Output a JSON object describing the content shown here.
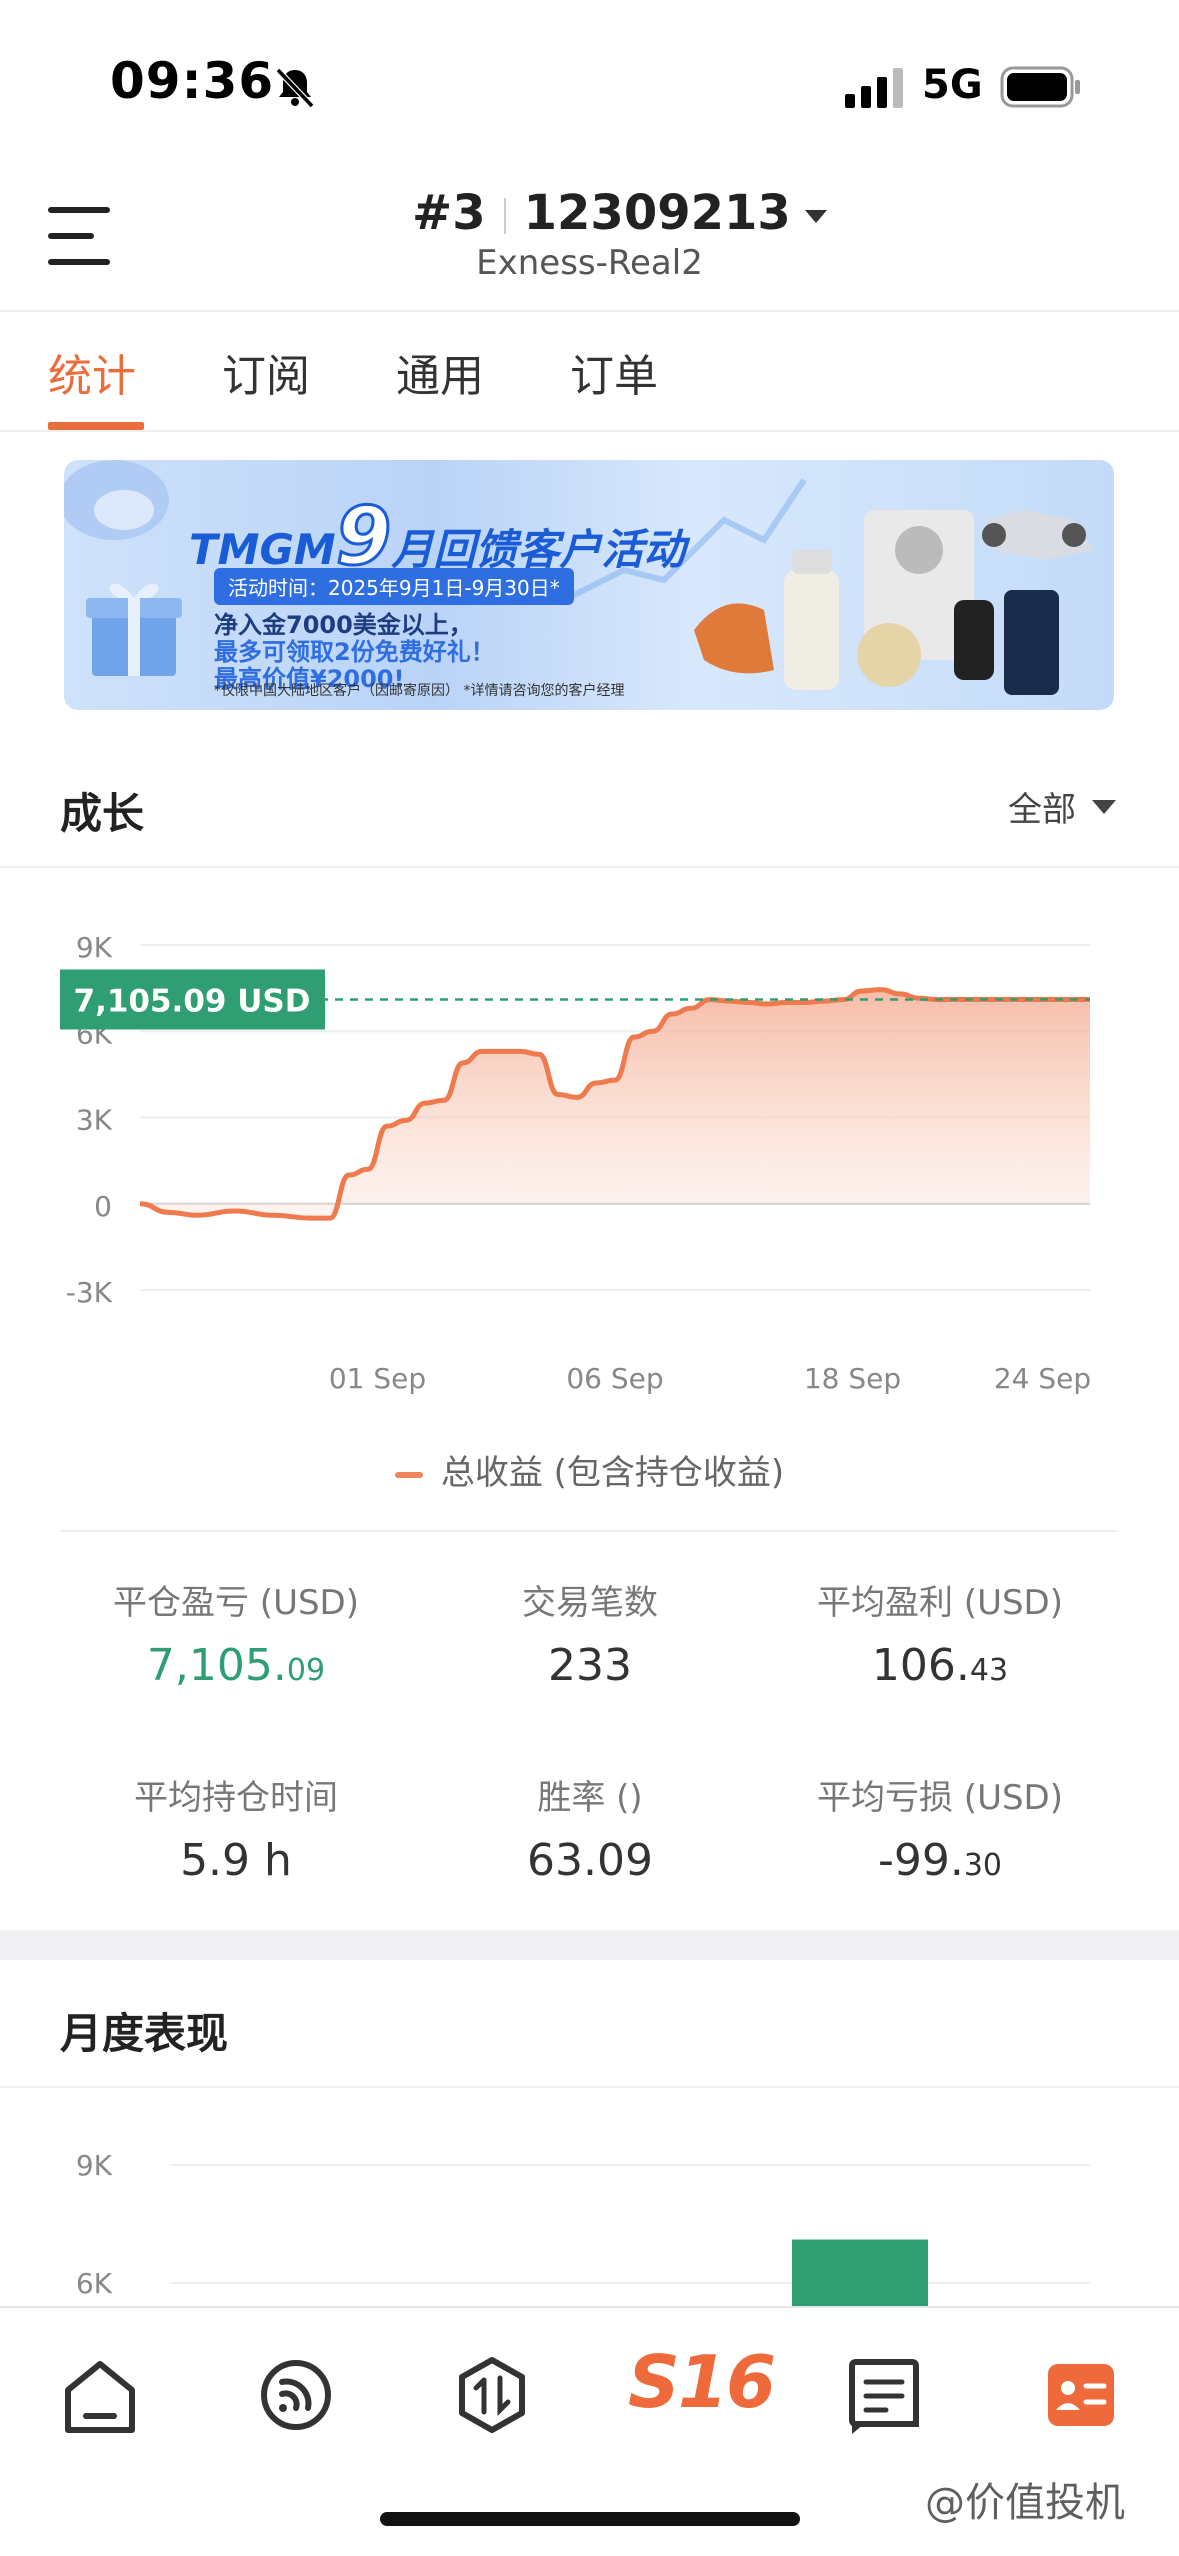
{
  "status_bar": {
    "time": "09:36",
    "network": "5G"
  },
  "header": {
    "account_index": "#3",
    "account_number": "12309213",
    "server": "Exness-Real2"
  },
  "tabs": [
    {
      "label": "统计",
      "active": true
    },
    {
      "label": "订阅",
      "active": false
    },
    {
      "label": "通用",
      "active": false
    },
    {
      "label": "订单",
      "active": false
    }
  ],
  "banner": {
    "brand": "TMGM",
    "month_num": "9",
    "title_rest": "月回馈客户活动",
    "date": "活动时间：2025年9月1日-9月30日*",
    "line1": "净入金7000美金以上，",
    "line2": "最多可领取2份免费好礼！",
    "line3": "最高价值¥2000!",
    "note": "*仅限中国大陆地区客户（因邮寄原因）  *详情请咨询您的客户经理"
  },
  "growth": {
    "title": "成长",
    "filter": "全部",
    "current_label": "7,105.09 USD",
    "legend": "总收益 (包含持仓收益)"
  },
  "chart_data": {
    "type": "area",
    "y_ticks": [
      "9K",
      "6K",
      "3K",
      "0",
      "-3K"
    ],
    "ylim": [
      -3000,
      9000
    ],
    "x_ticks": [
      "01 Sep",
      "06 Sep",
      "18 Sep",
      "24 Sep"
    ],
    "x_tick_positions": [
      0.25,
      0.5,
      0.75,
      0.95
    ],
    "current_value": 7105.09,
    "series": [
      {
        "name": "总收益 (包含持仓收益)",
        "x": [
          0,
          0.03,
          0.06,
          0.1,
          0.14,
          0.18,
          0.2,
          0.22,
          0.24,
          0.26,
          0.28,
          0.3,
          0.32,
          0.34,
          0.36,
          0.38,
          0.4,
          0.42,
          0.44,
          0.46,
          0.48,
          0.5,
          0.52,
          0.54,
          0.56,
          0.58,
          0.6,
          0.62,
          0.64,
          0.66,
          0.68,
          0.7,
          0.72,
          0.74,
          0.76,
          0.78,
          0.8,
          0.82,
          0.84,
          0.86,
          0.88,
          0.9,
          0.92,
          0.94,
          0.96,
          0.98,
          1.0
        ],
        "values": [
          0,
          -300,
          -400,
          -250,
          -400,
          -500,
          -500,
          1000,
          1200,
          2700,
          2900,
          3500,
          3600,
          4900,
          5300,
          5300,
          5300,
          5200,
          3800,
          3700,
          4200,
          4300,
          5800,
          6000,
          6600,
          6800,
          7100,
          7050,
          7000,
          6950,
          7000,
          7000,
          7050,
          7100,
          7400,
          7450,
          7300,
          7150,
          7100,
          7105,
          7105,
          7105,
          7105,
          7105,
          7105,
          7105,
          7105
        ]
      }
    ]
  },
  "stats": [
    {
      "label": "平仓盈亏 (USD)",
      "value_main": "7,105.",
      "value_dec": "09",
      "green": true
    },
    {
      "label": "交易笔数",
      "value_main": "233",
      "value_dec": "",
      "green": false
    },
    {
      "label": "平均盈利 (USD)",
      "value_main": "106.",
      "value_dec": "43",
      "green": false
    },
    {
      "label": "平均持仓时间",
      "value_main": "5.9 h",
      "value_dec": "",
      "green": false
    },
    {
      "label": "胜率 ()",
      "value_main": "63.09",
      "value_dec": "",
      "green": false
    },
    {
      "label": "平均亏损 (USD)",
      "value_main": "-99.",
      "value_dec": "30",
      "green": false
    }
  ],
  "monthly": {
    "title": "月度表现",
    "y_ticks": [
      "9K",
      "6K"
    ],
    "bar_value": 7105,
    "bar_color": "#2f9e72"
  },
  "bottom_nav": {
    "items": [
      "home-icon",
      "feed-icon",
      "trade-icon",
      "s16-logo",
      "message-icon",
      "account-card-icon"
    ],
    "logo_text": "S16",
    "active_color": "#ee6a3a"
  },
  "watermark": "@价值投机"
}
